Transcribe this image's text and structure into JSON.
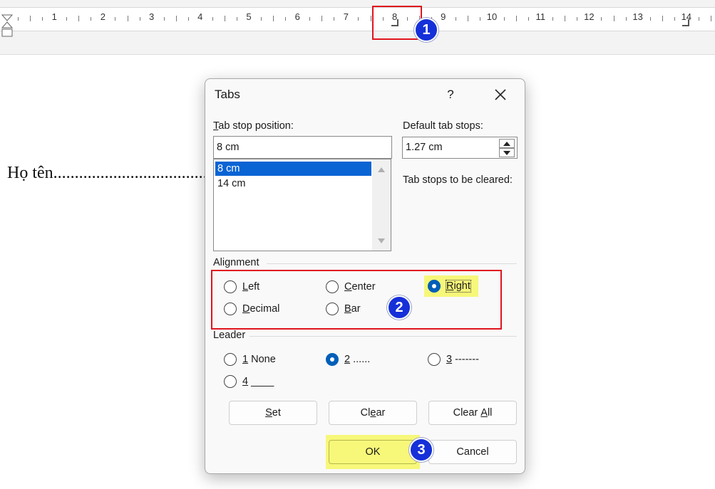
{
  "ruler": {
    "numbers": [
      "1",
      "2",
      "3",
      "4",
      "5",
      "6",
      "7",
      "8",
      "9",
      "10",
      "11",
      "12",
      "13",
      "14"
    ],
    "tab_stops_cm": [
      8,
      14
    ]
  },
  "document": {
    "text": "Họ tên........................................"
  },
  "callouts": {
    "step1": "1",
    "step2": "2",
    "step3": "3"
  },
  "dialog": {
    "title": "Tabs",
    "help": "?",
    "tab_stop_position": {
      "label_mnemonic": "T",
      "label_rest": "ab stop position:",
      "value": "8 cm",
      "list": [
        "8 cm",
        "14 cm"
      ],
      "selected_index": 0
    },
    "default_tab_stops": {
      "label": "Default tab stops:",
      "value": "1.27 cm"
    },
    "tab_stops_to_clear_label": "Tab stops to be cleared:",
    "alignment": {
      "label": "Alignment",
      "options": [
        {
          "mnemonic": "L",
          "rest": "eft",
          "selected": false
        },
        {
          "mnemonic": "C",
          "rest": "enter",
          "selected": false
        },
        {
          "mnemonic": "R",
          "rest": "ight",
          "selected": true
        },
        {
          "mnemonic": "D",
          "rest": "ecimal",
          "selected": false
        },
        {
          "mnemonic": "B",
          "rest": "ar",
          "selected": false
        }
      ]
    },
    "leader": {
      "label": "Leader",
      "options": [
        {
          "mnemonic": "1",
          "rest": " None",
          "selected": false
        },
        {
          "mnemonic": "2",
          "rest": " ......",
          "selected": true
        },
        {
          "mnemonic": "3",
          "rest": " -------",
          "selected": false
        },
        {
          "mnemonic": "4",
          "rest": " ____",
          "selected": false
        }
      ]
    },
    "buttons": {
      "set": {
        "mnemonic": "S",
        "rest": "et"
      },
      "clear": {
        "pre": "Cl",
        "mnemonic": "e",
        "rest": "ar"
      },
      "clear_all": {
        "pre": "Clear ",
        "mnemonic": "A",
        "rest": "ll"
      },
      "ok": "OK",
      "cancel": "Cancel"
    }
  },
  "colors": {
    "highlight": "#f7f77a",
    "callout_border": "#e0141e",
    "badge": "#1530d8",
    "selection": "#0a64d4"
  }
}
